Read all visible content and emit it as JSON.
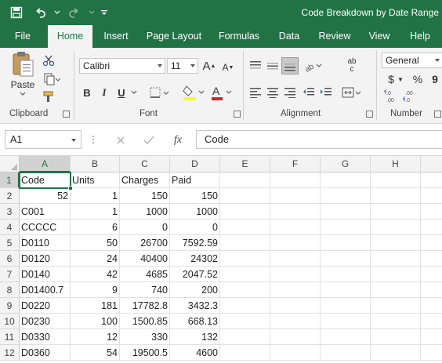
{
  "window": {
    "title": "Code Breakdown by Date Range"
  },
  "qat": {
    "save": "save-icon",
    "undo": "undo-icon",
    "redo": "redo-icon",
    "customize": "customize-qat-icon"
  },
  "tabs": [
    {
      "label": "File"
    },
    {
      "label": "Home"
    },
    {
      "label": "Insert"
    },
    {
      "label": "Page Layout"
    },
    {
      "label": "Formulas"
    },
    {
      "label": "Data"
    },
    {
      "label": "Review"
    },
    {
      "label": "View"
    },
    {
      "label": "Help"
    }
  ],
  "ribbon": {
    "clipboard": {
      "label": "Clipboard",
      "paste": "Paste"
    },
    "font": {
      "label": "Font",
      "family": "Calibri",
      "size": "11",
      "grow": "A",
      "shrink": "A",
      "bold": "B",
      "italic": "I",
      "underline": "U"
    },
    "alignment": {
      "label": "Alignment",
      "wrap": "ab c"
    },
    "number": {
      "label": "Number",
      "format": "General",
      "currency": "$",
      "percent": "%",
      "comma": "9"
    }
  },
  "formula_bar": {
    "name_box": "A1",
    "fx": "fx",
    "content": "Code"
  },
  "columns": [
    "A",
    "B",
    "C",
    "D",
    "E",
    "F",
    "G",
    "H"
  ],
  "rows": [
    {
      "n": "1",
      "a": "Code",
      "b": "Units",
      "c": "Charges",
      "d": "Paid"
    },
    {
      "n": "2",
      "a": "52",
      "b": "1",
      "c": "150",
      "d": "150"
    },
    {
      "n": "3",
      "a": "C001",
      "b": "1",
      "c": "1000",
      "d": "1000"
    },
    {
      "n": "4",
      "a": "CCCCC",
      "b": "6",
      "c": "0",
      "d": "0"
    },
    {
      "n": "5",
      "a": "D0110",
      "b": "50",
      "c": "26700",
      "d": "7592.59"
    },
    {
      "n": "6",
      "a": "D0120",
      "b": "24",
      "c": "40400",
      "d": "24302"
    },
    {
      "n": "7",
      "a": "D0140",
      "b": "42",
      "c": "4685",
      "d": "2047.52"
    },
    {
      "n": "8",
      "a": "D01400.7",
      "b": "9",
      "c": "740",
      "d": "200"
    },
    {
      "n": "9",
      "a": "D0220",
      "b": "181",
      "c": "17782.8",
      "d": "3432.3"
    },
    {
      "n": "10",
      "a": "D0230",
      "b": "100",
      "c": "1500.85",
      "d": "668.13"
    },
    {
      "n": "11",
      "a": "D0330",
      "b": "12",
      "c": "330",
      "d": "132"
    },
    {
      "n": "12",
      "a": "D0360",
      "b": "54",
      "c": "19500.5",
      "d": "4600"
    }
  ],
  "colors": {
    "accent": "#217346",
    "ribbon_bg": "#f3f3f3"
  }
}
